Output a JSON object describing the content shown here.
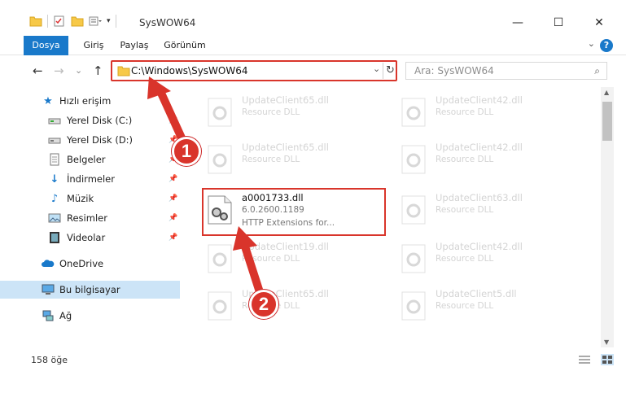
{
  "window": {
    "title": "SysWOW64",
    "controls": {
      "minimize": "—",
      "maximize": "☐",
      "close": "✕"
    }
  },
  "ribbon": {
    "tabs": [
      "Dosya",
      "Giriş",
      "Paylaş",
      "Görünüm"
    ],
    "help": "?"
  },
  "navigation": {
    "back": "←",
    "forward": "→",
    "recent": "⌄",
    "up": "↑",
    "address": "C:\\Windows\\SysWOW64",
    "search_placeholder": "Ara: SysWOW64"
  },
  "sidebar": {
    "items": [
      {
        "label": "Hızlı erişim",
        "icon": "star-icon"
      },
      {
        "label": "Yerel Disk (C:)",
        "icon": "drive-icon",
        "pinned": true
      },
      {
        "label": "Yerel Disk (D:)",
        "icon": "drive-icon",
        "pinned": true
      },
      {
        "label": "Belgeler",
        "icon": "documents-icon",
        "pinned": true
      },
      {
        "label": "İndirmeler",
        "icon": "download-icon",
        "pinned": true
      },
      {
        "label": "Müzik",
        "icon": "music-icon",
        "pinned": true
      },
      {
        "label": "Resimler",
        "icon": "pictures-icon",
        "pinned": true
      },
      {
        "label": "Videolar",
        "icon": "videos-icon",
        "pinned": true
      },
      {
        "label": "OneDrive",
        "icon": "cloud-icon"
      },
      {
        "label": "Bu bilgisayar",
        "icon": "computer-icon",
        "selected": true
      },
      {
        "label": "Ağ",
        "icon": "network-icon"
      }
    ]
  },
  "files": {
    "left": [
      {
        "name": "UpdateClient65.dll",
        "desc": "Resource DLL"
      },
      {
        "name": "UpdateClient65.dll",
        "desc": "Resource DLL"
      },
      {
        "name": "a0001733.dll",
        "version": "6.0.2600.1189",
        "desc": "HTTP Extensions for..."
      },
      {
        "name": "UpdateClient19.dll",
        "desc": "Resource DLL"
      },
      {
        "name": "UpdateClient65.dll",
        "desc": "Resource DLL"
      }
    ],
    "right": [
      {
        "name": "UpdateClient42.dll",
        "desc": "Resource DLL"
      },
      {
        "name": "UpdateClient42.dll",
        "desc": "Resource DLL"
      },
      {
        "name": "UpdateClient63.dll",
        "desc": "Resource DLL"
      },
      {
        "name": "UpdateClient42.dll",
        "desc": "Resource DLL"
      },
      {
        "name": "UpdateClient5.dll",
        "desc": "Resource DLL"
      }
    ]
  },
  "status": {
    "count": "158 öğe"
  },
  "callouts": [
    "1",
    "2"
  ],
  "colors": {
    "accent": "#1979ca",
    "highlight": "#d9352b",
    "selected": "#cce4f7"
  }
}
